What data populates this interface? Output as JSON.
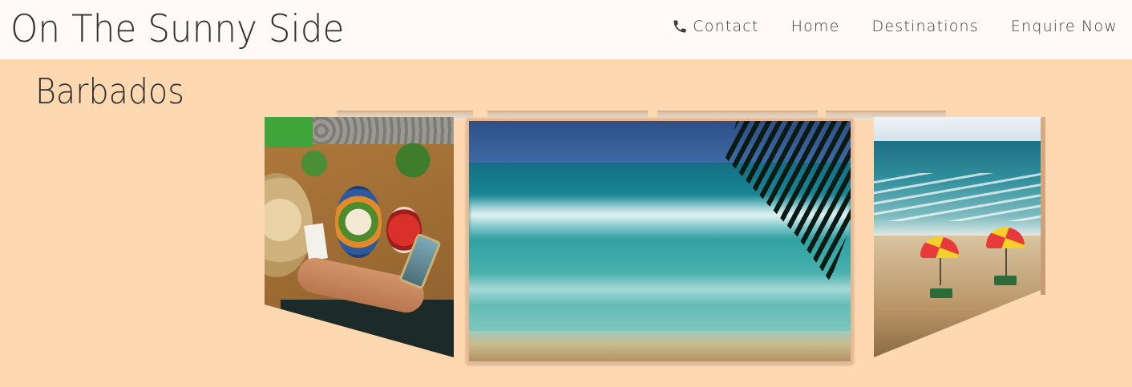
{
  "header": {
    "brand": "On The Sunny Side",
    "nav": [
      {
        "label": "Contact",
        "icon": "phone-icon"
      },
      {
        "label": "Home"
      },
      {
        "label": "Destinations"
      },
      {
        "label": "Enquire Now"
      }
    ]
  },
  "page": {
    "title": "Barbados"
  },
  "carousel": {
    "slides": [
      {
        "name": "food-table-photo"
      },
      {
        "name": "ocean-waves-photo"
      },
      {
        "name": "beach-umbrellas-photo"
      }
    ]
  },
  "colors": {
    "background": "#fed8b1",
    "header_bg": "#fffaf7",
    "text": "#3a3a3a",
    "frame": "#e8b991"
  }
}
